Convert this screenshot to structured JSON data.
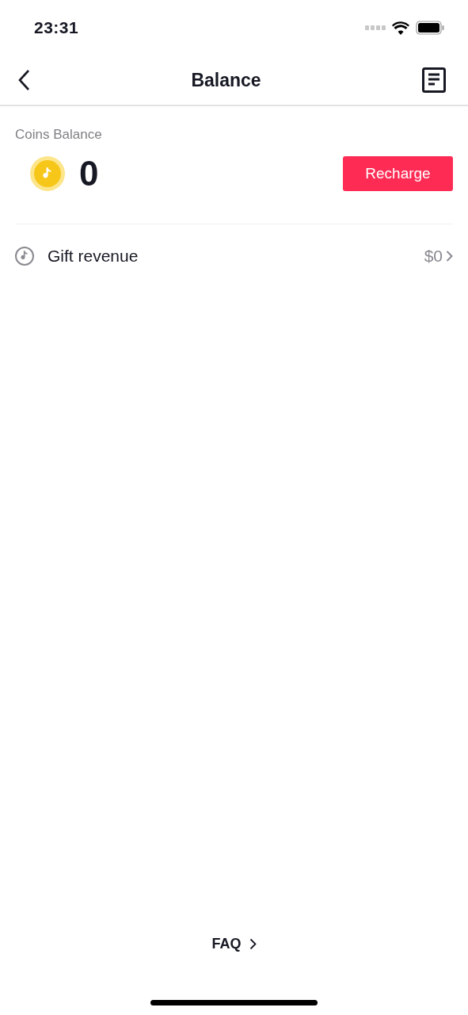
{
  "status_bar": {
    "time": "23:31"
  },
  "header": {
    "title": "Balance"
  },
  "coins": {
    "label": "Coins Balance",
    "amount": "0",
    "button": "Recharge"
  },
  "rows": [
    {
      "label": "Gift revenue",
      "value": "$0"
    }
  ],
  "footer": {
    "link": "FAQ"
  }
}
